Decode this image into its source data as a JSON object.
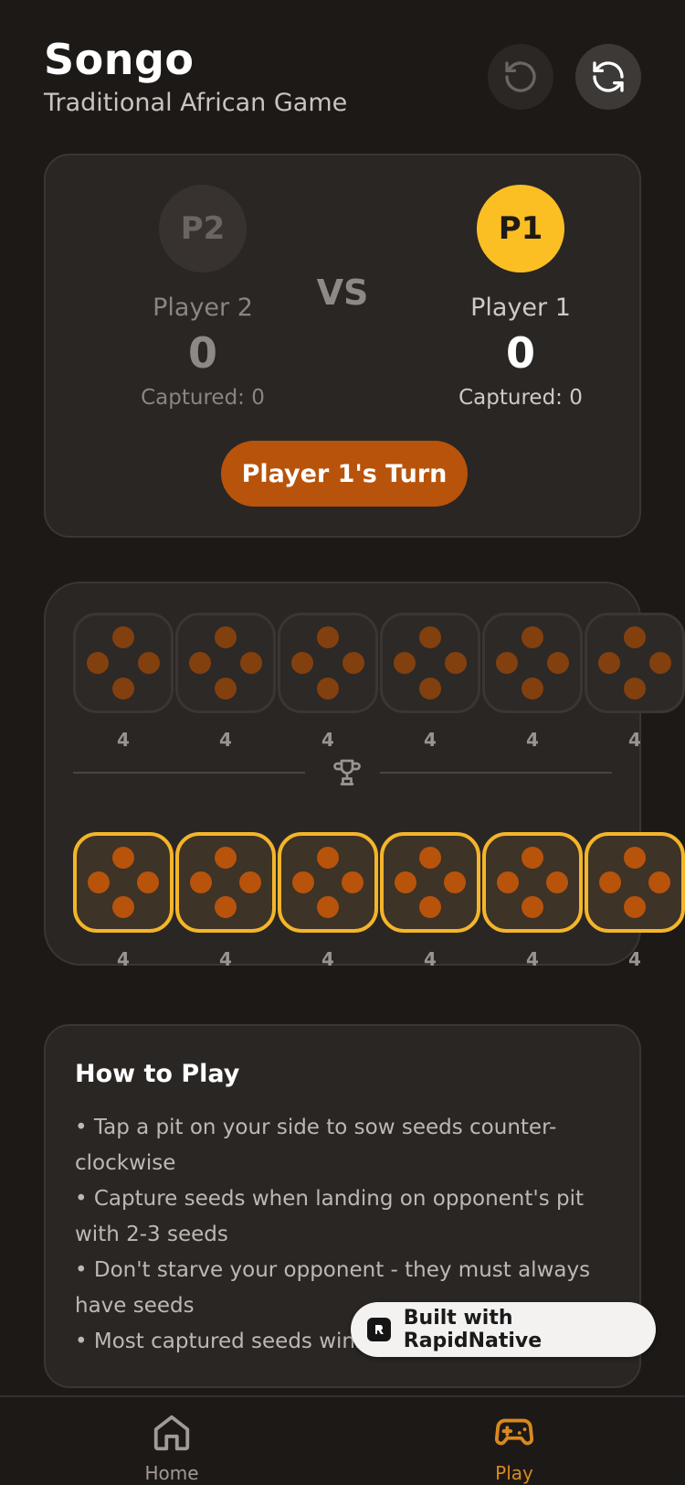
{
  "header": {
    "title": "Songo",
    "subtitle": "Traditional African Game",
    "undo_icon": "undo-icon",
    "reset_icon": "refresh-icon"
  },
  "scoreboard": {
    "player2": {
      "avatar": "P2",
      "name": "Player 2",
      "score": "0",
      "captured": "Captured: 0"
    },
    "player1": {
      "avatar": "P1",
      "name": "Player 1",
      "score": "0",
      "captured": "Captured: 0"
    },
    "vs": "VS",
    "turn_label": "Player 1's Turn"
  },
  "board": {
    "top_row": [
      4,
      4,
      4,
      4,
      4,
      4
    ],
    "bottom_row": [
      4,
      4,
      4,
      4,
      4,
      4
    ],
    "divider_icon": "trophy-icon"
  },
  "how_to_play": {
    "title": "How to Play",
    "rules": [
      "• Tap a pit on your side to sow seeds counter-clockwise",
      "• Capture seeds when landing on opponent's pit with 2-3 seeds",
      "• Don't starve your opponent - they must always have seeds",
      "• Most captured seeds wins"
    ]
  },
  "badge": {
    "text": "Built with RapidNative"
  },
  "tabbar": {
    "tabs": [
      {
        "label": "Home",
        "icon": "home-icon",
        "active": false
      },
      {
        "label": "Play",
        "icon": "gamepad-icon",
        "active": true
      }
    ]
  },
  "colors": {
    "background": "#1d1917",
    "card": "#2a2624",
    "accent_yellow": "#fbbf24",
    "accent_orange": "#b8530b"
  }
}
